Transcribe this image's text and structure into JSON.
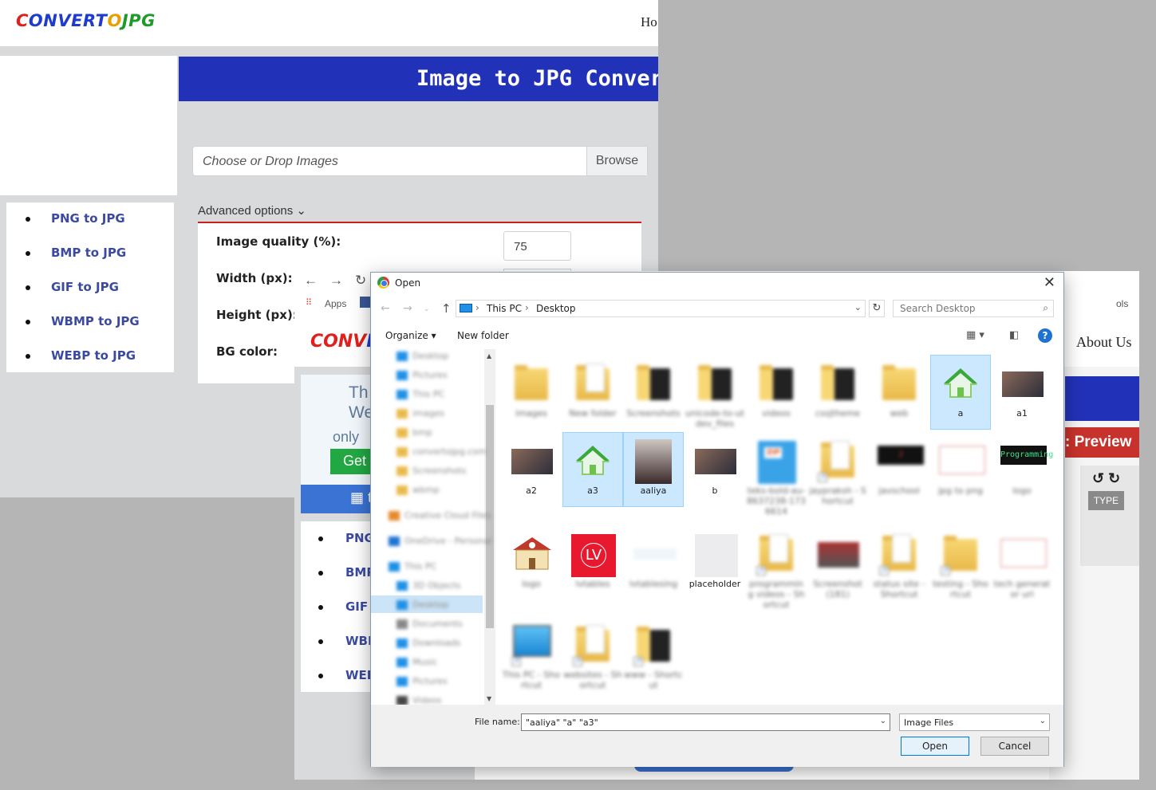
{
  "site": {
    "logo_parts": [
      "C",
      "ONVERT",
      "O",
      "JPG"
    ],
    "nav_partial": "Ho",
    "banner_title": "Image to JPG Converter",
    "drop_placeholder": "Choose or Drop Images",
    "browse_label": "Browse",
    "advanced_label": "Advanced options ⌄",
    "options": {
      "quality_label": "Image quality (%):",
      "quality_value": "75",
      "width_label": "Width (px):",
      "height_label": "Height (px):",
      "bg_label": "BG color:"
    },
    "sidebar": [
      "PNG to JPG",
      "BMP to JPG",
      "GIF to JPG",
      "WBMP to JPG",
      "WEBP to JPG"
    ]
  },
  "second_window": {
    "apps_label": "Apps",
    "bm_partial": "ols",
    "logo_parts": [
      "CONV",
      "E"
    ],
    "ad_line1": "Th",
    "ad_line2": "Web",
    "ad_line3": "only",
    "ad_button": "Get",
    "bluebar_icon": "grid-icon",
    "bluebar_text": "t",
    "sidebar_partial": [
      "PNG",
      "BMP",
      "GIF t",
      "WBM",
      "WEB"
    ],
    "about_us": "About Us",
    "preview_label": ": Preview",
    "type_button": "TYPE",
    "rotate_glyphs": "↺ ↻"
  },
  "dialog": {
    "title": "Open",
    "close_glyph": "✕",
    "breadcrumb": [
      "This PC",
      "Desktop"
    ],
    "search_placeholder": "Search Desktop",
    "organize_label": "Organize ▾",
    "new_folder_label": "New folder",
    "nav_items": [
      "Desktop",
      "Pictures",
      "This PC",
      "images",
      "bmp",
      "convertojpg.com",
      "Screenshots",
      "wbmp",
      "Creative Cloud Files",
      "OneDrive - Personal",
      "This PC",
      "3D Objects",
      "Desktop",
      "Documents",
      "Downloads",
      "Music",
      "Pictures",
      "Videos"
    ],
    "files": [
      {
        "name": "images",
        "kind": "folder",
        "blurred": true
      },
      {
        "name": "New folder",
        "kind": "folder-paper",
        "blurred": true
      },
      {
        "name": "Screenshots",
        "kind": "folder-dark",
        "blurred": true
      },
      {
        "name": "unicode-to-utdev_files",
        "kind": "folder-dark",
        "blurred": true
      },
      {
        "name": "videos",
        "kind": "folder-dark",
        "blurred": true
      },
      {
        "name": "cssjtheme",
        "kind": "folder-dark",
        "blurred": true
      },
      {
        "name": "web",
        "kind": "folder",
        "blurred": true
      },
      {
        "name": "a",
        "kind": "house",
        "blurred": false,
        "selected": true
      },
      {
        "name": "a1",
        "kind": "photo",
        "blurred": false
      },
      {
        "name": "a2",
        "kind": "photo",
        "blurred": false
      },
      {
        "name": "a3",
        "kind": "house",
        "blurred": false,
        "selected": true
      },
      {
        "name": "aaliya",
        "kind": "photo",
        "blurred": false,
        "selected": true
      },
      {
        "name": "b",
        "kind": "photo",
        "blurred": false
      },
      {
        "name": "teks-bold-au-8637238-1736614",
        "kind": "zip",
        "blurred": true
      },
      {
        "name": "jaypraksh - Shortcut",
        "kind": "folder-paper",
        "blurred": true
      },
      {
        "name": "javschool",
        "kind": "prog",
        "blurred": true
      },
      {
        "name": "jpg to png",
        "kind": "doc",
        "blurred": true
      },
      {
        "name": "logo",
        "kind": "prog-text",
        "blurred": true
      },
      {
        "name": "logo",
        "kind": "school",
        "blurred": true
      },
      {
        "name": "lvtables",
        "kind": "lv",
        "blurred": true
      },
      {
        "name": "lvtablesing",
        "kind": "blank-light",
        "blurred": true
      },
      {
        "name": "placeholder",
        "kind": "blank",
        "blurred": false
      },
      {
        "name": "programming videos - Shortcut",
        "kind": "folder-paper",
        "blurred": true
      },
      {
        "name": "Screenshot (181)",
        "kind": "photo-red",
        "blurred": true
      },
      {
        "name": "status site - Shortcut",
        "kind": "folder-paper",
        "blurred": true
      },
      {
        "name": "testing - Shortcut",
        "kind": "folder",
        "blurred": true
      },
      {
        "name": "tech generator url",
        "kind": "doc",
        "blurred": true
      },
      {
        "name": "This PC - Shortcut",
        "kind": "monitor",
        "blurred": true
      },
      {
        "name": "websites - Shortcut",
        "kind": "folder-paper",
        "blurred": true
      },
      {
        "name": "www - Shortcut",
        "kind": "folder-dark",
        "blurred": true
      }
    ],
    "file_name_label": "File name:",
    "file_name_value": "\"aaliya\" \"a\" \"a3\"",
    "file_type_value": "Image Files",
    "open_label": "Open",
    "cancel_label": "Cancel",
    "prog_text": "Programming",
    "lv_text": "LV"
  }
}
